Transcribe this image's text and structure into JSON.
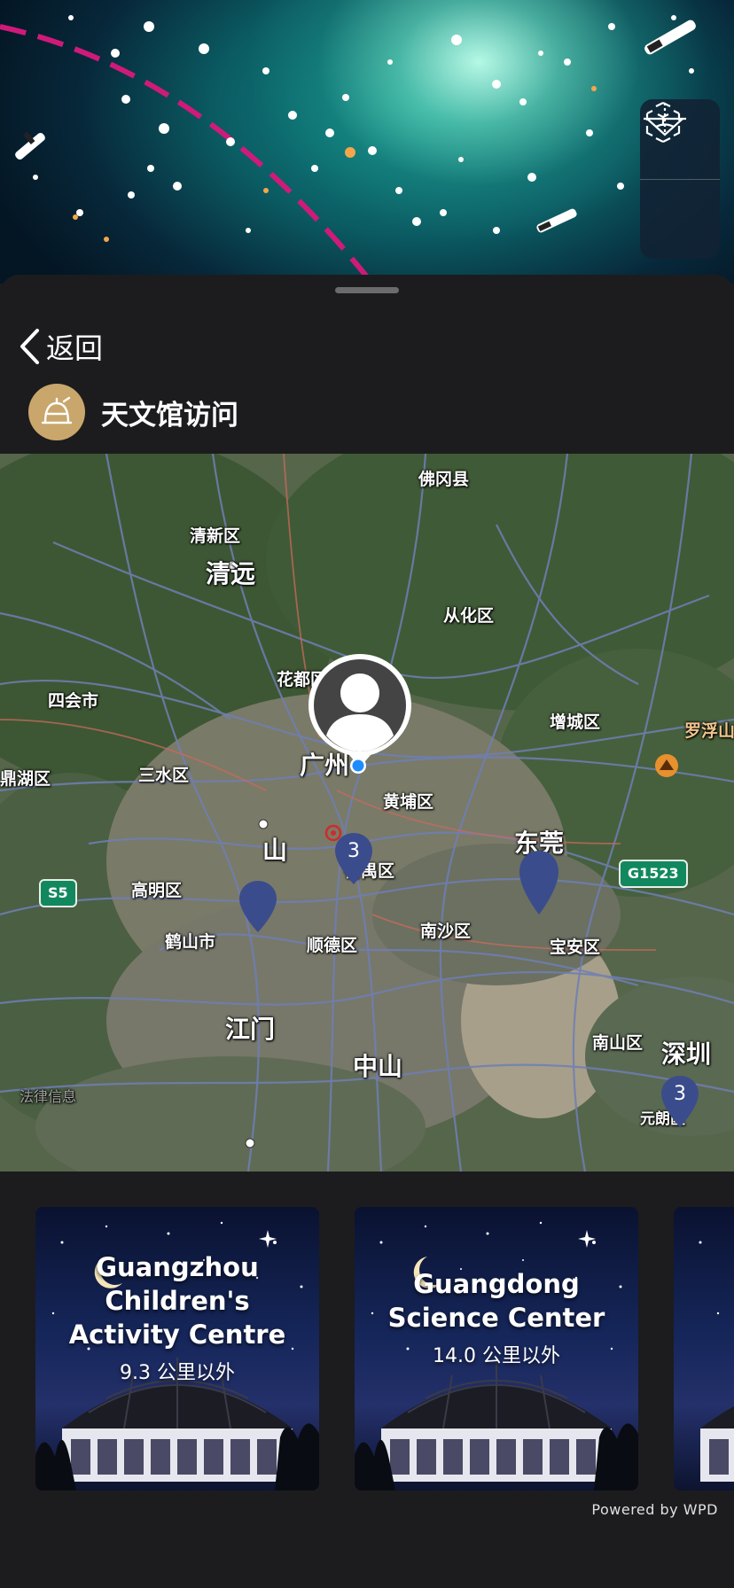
{
  "header": {
    "back_label": "返回",
    "section_title": "天文馆访问",
    "view_controls": [
      {
        "name": "3d-cube-view",
        "icon": "cube-icon"
      },
      {
        "name": "horizon-view",
        "icon": "horizon-angle-icon"
      }
    ]
  },
  "map": {
    "labels": {
      "fogang": "佛冈县",
      "qingxin": "清新区",
      "qingyuan": "清远",
      "conghua": "从化区",
      "huadu": "花都区",
      "sihui": "四会市",
      "zengcheng": "增城区",
      "luofushan": "罗浮山",
      "guangzhou": "广州",
      "sanshui": "三水区",
      "dinghu": "鼎湖区",
      "huangpu": "黄埔区",
      "foshan": "山",
      "dongguan": "东莞",
      "panyu": "番禺区",
      "gaoming": "高明区",
      "heshan": "鹤山市",
      "shunde": "顺德区",
      "nansha": "南沙区",
      "baoan": "宝安区",
      "jiangmen": "江门",
      "zhongshan": "中山",
      "nanshan": "南山区",
      "shenzhen": "深圳",
      "yuanlang": "元朗区",
      "legal": "法律信息"
    },
    "road_badges": {
      "s5": "S5",
      "g1523": "G1523"
    },
    "clusters": [
      {
        "name": "cluster-guangzhou",
        "count": "3"
      },
      {
        "name": "cluster-shenzhen",
        "count": "3"
      }
    ]
  },
  "cards": [
    {
      "title": "Guangzhou Children's Activity Centre",
      "distance": "9.3 公里以外"
    },
    {
      "title": "Guangdong Science Center",
      "distance": "14.0 公里以外"
    },
    {
      "title": "",
      "distance": ""
    }
  ],
  "footer": {
    "powered_by": "Powered by WPD"
  },
  "colors": {
    "sheet_bg": "#1c1c1e",
    "badge_gold": "#c9a66b",
    "marker_blue": "#3b4c8c",
    "user_dot": "#1e8bff"
  }
}
